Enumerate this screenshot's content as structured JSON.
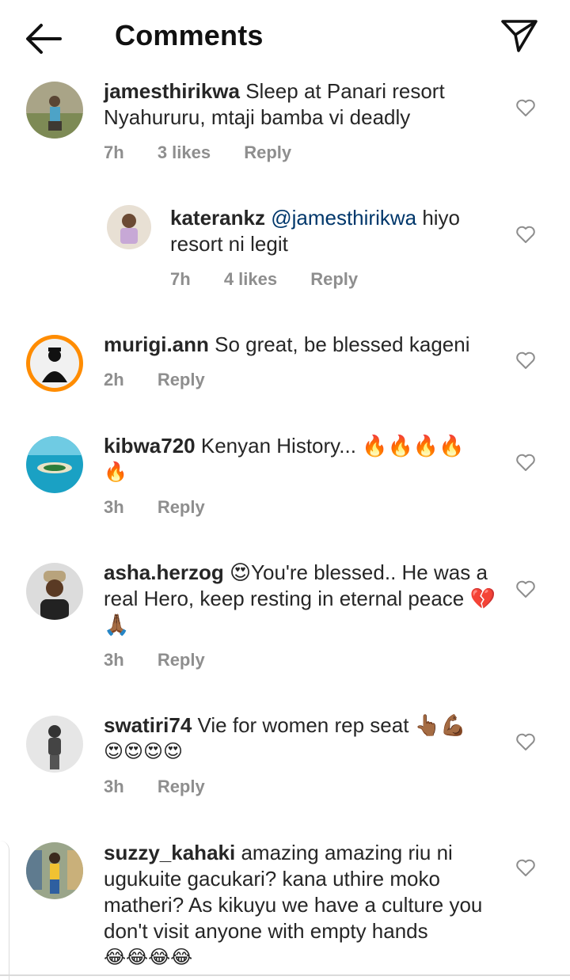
{
  "header": {
    "title": "Comments",
    "back_icon": "arrow-left-icon",
    "share_icon": "send-icon"
  },
  "comments": [
    {
      "username": "jamesthirikwa",
      "text": "Sleep at Panari resort Nyahururu, mtaji bamba vi deadly",
      "time": "7h",
      "likes": "3 likes",
      "reply": "Reply"
    },
    {
      "username": "katerankz",
      "mention": "@jamesthirikwa",
      "text": " hiyo resort  ni legit",
      "time": "7h",
      "likes": "4 likes",
      "reply": "Reply"
    },
    {
      "username": "murigi.ann",
      "text": "So great, be blessed kageni",
      "time": "2h",
      "reply": "Reply"
    },
    {
      "username": "kibwa720",
      "text": "Kenyan History... 🔥🔥🔥🔥",
      "text2": "🔥",
      "time": "3h",
      "reply": "Reply"
    },
    {
      "username": "asha.herzog",
      "text": "😍You're blessed.. He was a real Hero, keep resting in eternal peace 💔🙏🏾",
      "time": "3h",
      "reply": "Reply"
    },
    {
      "username": "swatiri74",
      "text": "Vie for women rep seat 👆🏾💪🏾",
      "text2": "😍😍😍😍",
      "time": "3h",
      "reply": "Reply"
    },
    {
      "username": "suzzy_kahaki",
      "text": "amazing amazing riu ni ugukuite gacukari? kana uthire moko matheri? As kikuyu we have a culture you don't visit anyone with empty hands",
      "text2": "😂😂😂😂"
    }
  ]
}
